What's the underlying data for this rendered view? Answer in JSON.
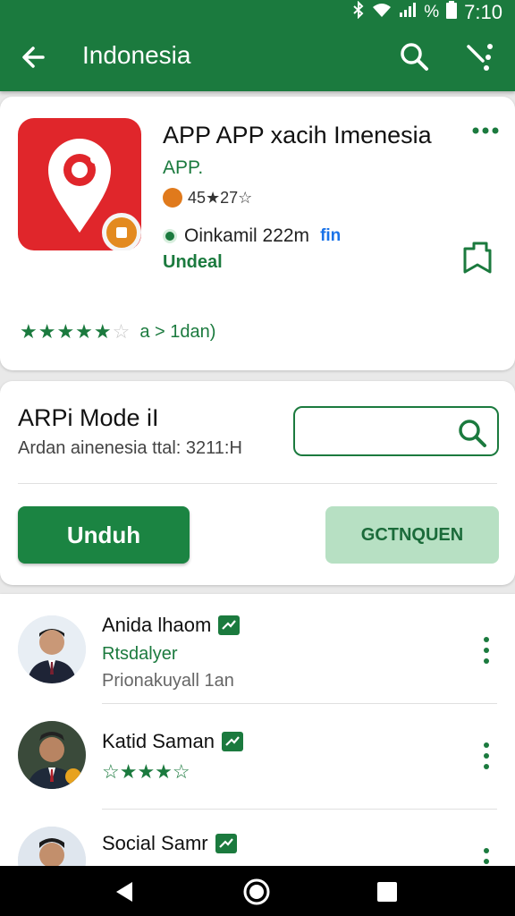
{
  "status_bar": {
    "battery": "%",
    "time": "7:10"
  },
  "toolbar": {
    "title": "Indonesia"
  },
  "app": {
    "title": "APP APP xacih Imenesia",
    "developer": "APP.",
    "rating_text": "45★27☆",
    "installs": "Oinkamil 222m",
    "installs_tag": "fin",
    "status": "Undeal",
    "stars": "★★★★★",
    "stars_faded": "☆",
    "stars_text": "a  >  1dan)"
  },
  "model": {
    "title": "ARPi Mode iI",
    "subtitle": "Ardan ainenesia ttal: 3211:H",
    "search_placeholder": "",
    "primary_button": "Unduh",
    "secondary_button": "GCTNQUEN"
  },
  "people": [
    {
      "name": "Anida lhaom",
      "line2": "Rtsdalyer",
      "line3": "Prionakuyall 1an"
    },
    {
      "name": "Katid Saman",
      "line2": "☆★★★☆",
      "line3": ""
    },
    {
      "name": "Social Samr",
      "line2": "",
      "line3": ""
    }
  ],
  "colors": {
    "primary": "#1b7a3e",
    "app_icon": "#e0262b",
    "secondary_button": "#b7e0c3"
  }
}
